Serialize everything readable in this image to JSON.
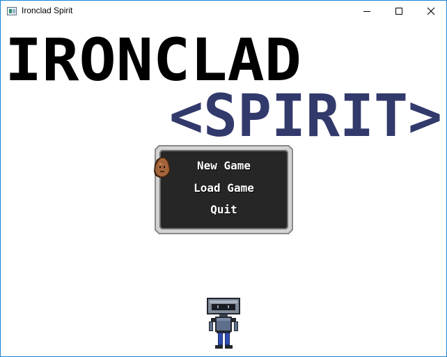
{
  "window": {
    "title": "Ironclad Spirit",
    "controls": [
      "minimize-icon",
      "maximize-icon",
      "close-icon"
    ]
  },
  "logo": {
    "line1": "IRONCLAD",
    "line2": "<SPIRIT>",
    "colors": {
      "line1": "#000000",
      "line2": "#32396b"
    }
  },
  "menu": {
    "items": [
      "New Game",
      "Load Game",
      "Quit"
    ],
    "selected": "New Game",
    "colors": {
      "panel_bg": "#262626",
      "panel_frame": "#cfcfcf"
    }
  },
  "sprites": {
    "cursor": "potato-cursor-icon",
    "character": "robot-knight-sprite"
  }
}
